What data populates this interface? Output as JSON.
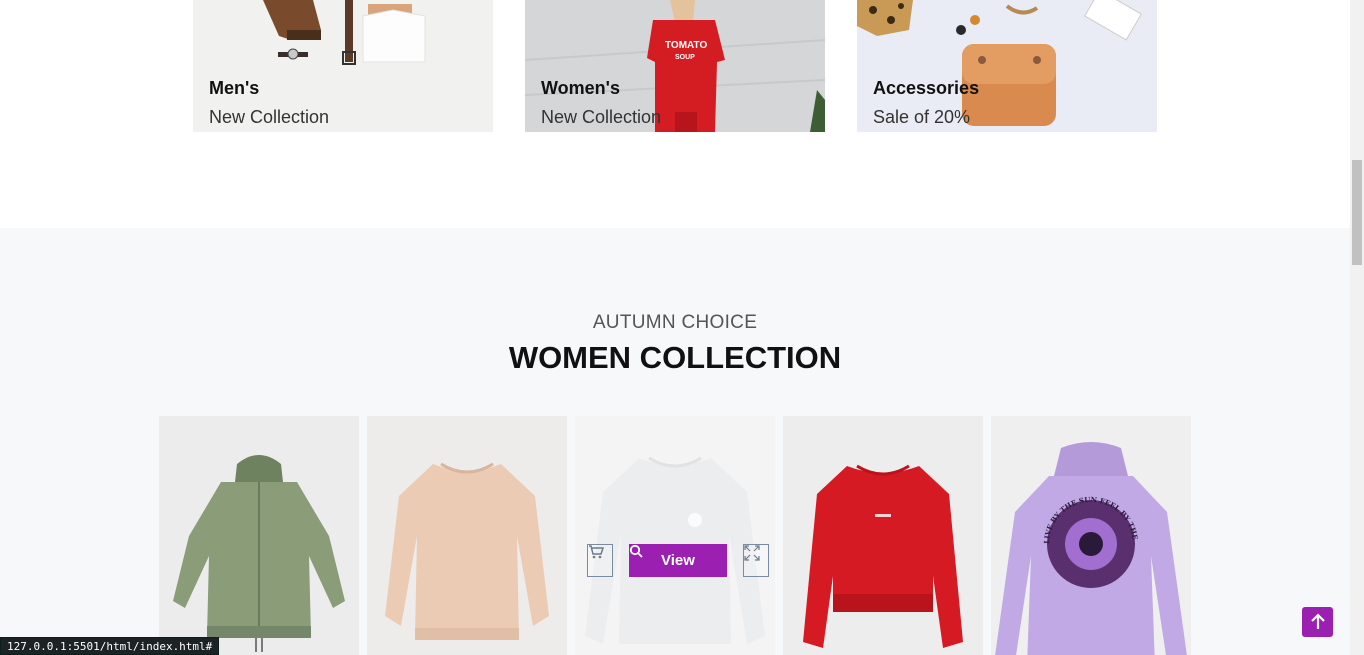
{
  "categories": [
    {
      "title": "Men's",
      "subtitle": "New Collection"
    },
    {
      "title": "Women's",
      "subtitle": "New Collection"
    },
    {
      "title": "Accessories",
      "subtitle": "Sale of 20%"
    }
  ],
  "collection": {
    "eyebrow": "AUTUMN CHOICE",
    "heading": "WOMEN COLLECTION"
  },
  "products": [
    {
      "icon": "green-jacket-image"
    },
    {
      "icon": "beige-sweatshirt-image"
    },
    {
      "icon": "grey-sweatshirt-image",
      "hover": true,
      "view_label": "View"
    },
    {
      "icon": "red-sweatshirt-image"
    },
    {
      "icon": "lavender-hoodie-image"
    }
  ],
  "hoodie_print": "LIVE BY THE SUN   FEEL BY THE MOON   MOVE BY THE STARS",
  "status_bar_url": "127.0.0.1:5501/html/index.html#",
  "colors": {
    "accent": "#9b1fb0",
    "section_bg": "#f7f8fa"
  }
}
